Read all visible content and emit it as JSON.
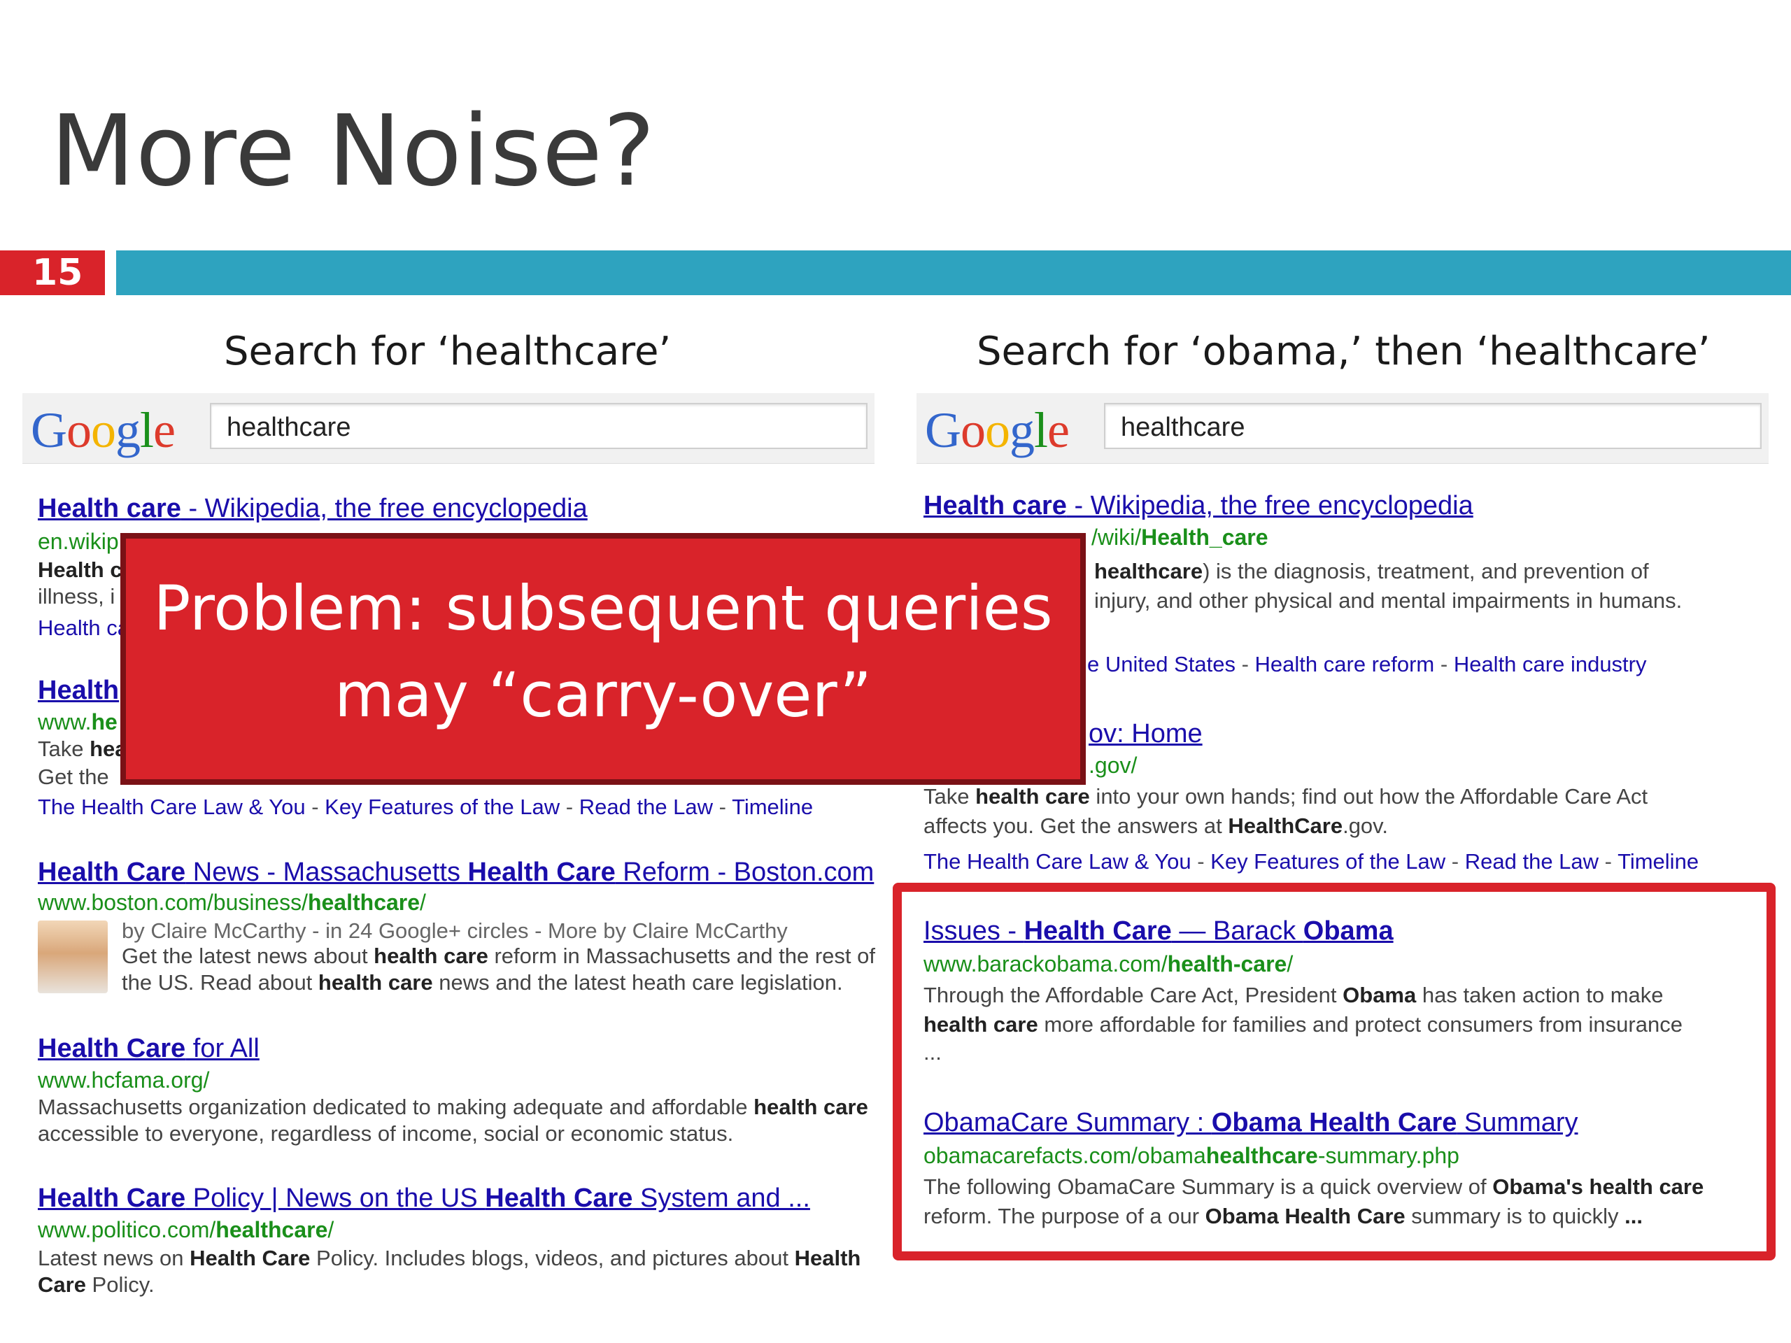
{
  "slide": {
    "title": "More Noise?",
    "number": "15"
  },
  "left": {
    "heading": "Search for ‘healthcare’",
    "logo_letters": [
      {
        "ch": "G",
        "color": "#3366cc"
      },
      {
        "ch": "o",
        "color": "#dd3b2c"
      },
      {
        "ch": "o",
        "color": "#f4b400"
      },
      {
        "ch": "g",
        "color": "#3366cc"
      },
      {
        "ch": "l",
        "color": "#1a8f1a"
      },
      {
        "ch": "e",
        "color": "#dd3b2c"
      }
    ],
    "query": "healthcare",
    "r1": {
      "title_a": "Health care",
      "title_b": " - Wikipedia, the free encyclopedia",
      "url": "en.wikip",
      "snip1": "Health c",
      "snip2": "illness, i",
      "links": "Health ca"
    },
    "r2": {
      "title": "Health",
      "url_a": "www.",
      "url_b": "he",
      "snip1_a": "Take ",
      "snip1_b": "hea",
      "snip2": "Get the",
      "links": [
        "The Health Care Law & You",
        "Key Features of the Law",
        "Read the Law",
        "Timeline"
      ]
    },
    "r3": {
      "title": [
        [
          "b",
          "Health Care"
        ],
        [
          "n",
          " News - Massachusetts "
        ],
        [
          "b",
          "Health Care"
        ],
        [
          "n",
          " Reform - Boston.com"
        ]
      ],
      "url_a": "www.boston.com/business/",
      "url_b": "healthcare",
      "url_c": "/",
      "byline": "by Claire McCarthy - in 24 Google+ circles - More by Claire McCarthy",
      "snip1": [
        [
          "n",
          "Get the latest news about "
        ],
        [
          "b",
          "health care"
        ],
        [
          "n",
          " reform in Massachusetts and the rest of"
        ]
      ],
      "snip2": [
        [
          "n",
          "the US. Read about "
        ],
        [
          "b",
          "health care"
        ],
        [
          "n",
          " news and the latest heath care legislation."
        ]
      ]
    },
    "r4": {
      "title": [
        [
          "b",
          "Health Care"
        ],
        [
          "n",
          " for All"
        ]
      ],
      "url": "www.hcfama.org/",
      "snip1": [
        [
          "n",
          "Massachusetts organization dedicated to making adequate and affordable "
        ],
        [
          "b",
          "health care"
        ]
      ],
      "snip2": [
        [
          "n",
          "accessible to everyone, regardless of income, social or economic status."
        ]
      ]
    },
    "r5": {
      "title": [
        [
          "b",
          "Health Care"
        ],
        [
          "n",
          " Policy | News on the US "
        ],
        [
          "b",
          "Health Care"
        ],
        [
          "n",
          " System and ..."
        ]
      ],
      "url_a": "www.politico.com/",
      "url_b": "healthcare",
      "url_c": "/",
      "snip1": [
        [
          "n",
          "Latest news on "
        ],
        [
          "b",
          "Health Care"
        ],
        [
          "n",
          " Policy. Includes blogs, videos, and pictures about "
        ],
        [
          "b",
          "Health"
        ]
      ],
      "snip2": [
        [
          "b",
          "Care"
        ],
        [
          "n",
          " Policy."
        ]
      ]
    }
  },
  "right": {
    "heading": "Search for ‘obama,’ then ‘healthcare’",
    "query": "healthcare",
    "r1": {
      "title_a": "Health care",
      "title_b": " - Wikipedia, the free encyclopedia",
      "url_a": "/wiki/",
      "url_b": "Health_care",
      "snip1": [
        [
          "b",
          "healthcare"
        ],
        [
          "n",
          ") is the diagnosis, treatment, and prevention of"
        ]
      ],
      "snip2": [
        [
          "n",
          "injury, and other physical and mental impairments in humans."
        ]
      ],
      "links": [
        "e United States",
        "Health care reform",
        "Health care industry"
      ]
    },
    "r2": {
      "title": "ov: Home",
      "url": ".gov/",
      "snip1": [
        [
          "n",
          "Take "
        ],
        [
          "b",
          "health care"
        ],
        [
          "n",
          " into your own hands; find out how the Affordable Care Act"
        ]
      ],
      "snip2": [
        [
          "n",
          "affects you. Get the answers at "
        ],
        [
          "b",
          "HealthCare"
        ],
        [
          "n",
          ".gov."
        ]
      ],
      "links": [
        "The Health Care Law & You",
        "Key Features of the Law",
        "Read the Law",
        "Timeline"
      ]
    },
    "r3": {
      "title": [
        [
          "n",
          "Issues - "
        ],
        [
          "b",
          "Health Care"
        ],
        [
          "n",
          " — Barack "
        ],
        [
          "b",
          "Obama"
        ]
      ],
      "url_a": "www.barackobama.com/",
      "url_b": "health-care",
      "url_c": "/",
      "snip1": [
        [
          "n",
          "Through the Affordable Care Act, President "
        ],
        [
          "b",
          "Obama"
        ],
        [
          "n",
          " has taken action to make"
        ]
      ],
      "snip2": [
        [
          "b",
          "health care"
        ],
        [
          "n",
          " more affordable for families and protect consumers from insurance"
        ]
      ],
      "snip3": "..."
    },
    "r4": {
      "title": [
        [
          "n",
          "ObamaCare Summary : "
        ],
        [
          "b",
          "Obama Health Care"
        ],
        [
          "n",
          " Summary"
        ]
      ],
      "url_a": "obamacarefacts.com/obama",
      "url_b": "healthcare",
      "url_c": "-summary.php",
      "snip1": [
        [
          "n",
          "The following ObamaCare Summary is a quick overview of "
        ],
        [
          "b",
          "Obama's health care"
        ]
      ],
      "snip2": [
        [
          "n",
          "reform. The purpose of a our "
        ],
        [
          "b",
          "Obama Health Care"
        ],
        [
          "n",
          " summary is to quickly "
        ],
        [
          "b",
          "..."
        ]
      ]
    }
  },
  "callout": {
    "line1": "Problem: subsequent queries",
    "line2": "may “carry-over”"
  },
  "colors": {
    "accent_red": "#d9232a",
    "accent_teal": "#2ea3bf",
    "link_blue": "#1a0dab",
    "url_green": "#1a8f1a"
  }
}
